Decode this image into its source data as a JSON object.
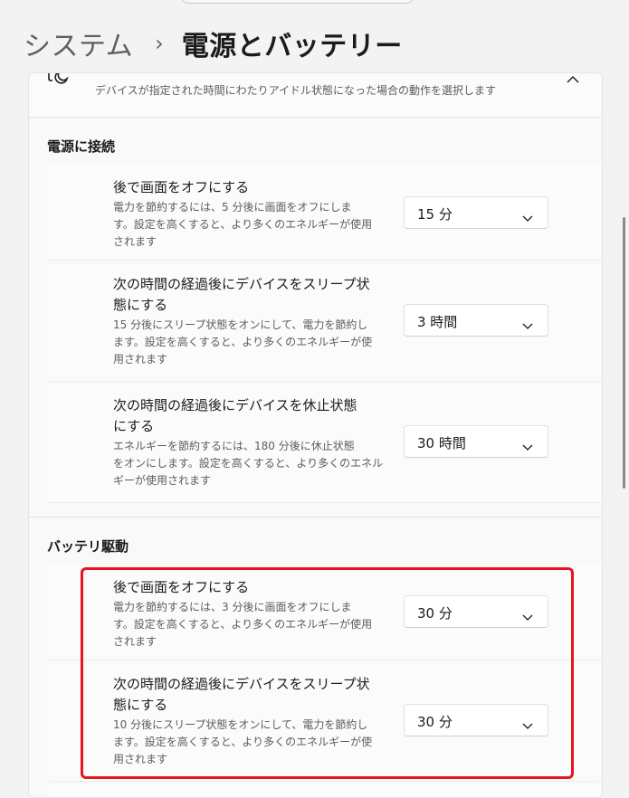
{
  "breadcrumb": {
    "parent": "システム",
    "separator": "›",
    "current": "電源とバッテリー"
  },
  "header": {
    "icon": "moon-icon",
    "description": "デバイスが指定された時間にわたりアイドル状態になった場合の動作を選択します",
    "collapse_icon": "chevron-up-icon"
  },
  "sections": [
    {
      "title": "電源に接続",
      "rows": [
        {
          "title_lines": [
            "後で画面をオフにする"
          ],
          "desc_lines": [
            "電力を節約するには、5 分後に画面をオフにしま",
            "す。設定を高くすると、より多くのエネルギーが使用",
            "されます"
          ],
          "value": "15 分"
        },
        {
          "title_lines": [
            "次の時間の経過後にデバイスをスリープ状",
            "態にする"
          ],
          "desc_lines": [
            "15 分後にスリープ状態をオンにして、電力を節約し",
            "ます。設定を高くすると、より多くのエネルギーが使",
            "用されます"
          ],
          "value": "3 時間"
        },
        {
          "title_lines": [
            "次の時間の経過後にデバイスを休止状態",
            "にする"
          ],
          "desc_lines": [
            "エネルギーを節約するには、180 分後に休止状態",
            "をオンにします。設定を高くすると、より多くのエネル",
            "ギーが使用されます"
          ],
          "value": "30 時間"
        }
      ]
    },
    {
      "title": "バッテリ駆動",
      "rows": [
        {
          "title_lines": [
            "後で画面をオフにする"
          ],
          "desc_lines": [
            "電力を節約するには、3 分後に画面をオフにしま",
            "す。設定を高くすると、より多くのエネルギーが使用",
            "されます"
          ],
          "value": "30 分"
        },
        {
          "title_lines": [
            "次の時間の経過後にデバイスをスリープ状",
            "態にする"
          ],
          "desc_lines": [
            "10 分後にスリープ状態をオンにして、電力を節約し",
            "ます。設定を高くすると、より多くのエネルギーが使",
            "用されます"
          ],
          "value": "30 分"
        }
      ]
    }
  ],
  "colors": {
    "highlight": "#e8141f",
    "background": "#f3f3f3",
    "card": "#f9f9f9"
  }
}
